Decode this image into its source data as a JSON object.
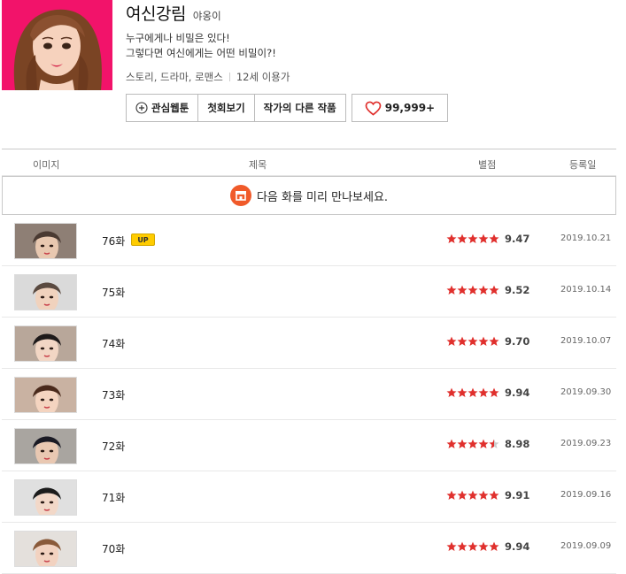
{
  "webtoon": {
    "title": "여신강림",
    "author": "야옹이",
    "synopsis": [
      "누구에게나 비밀은 있다!",
      "그렇다면 여신에게는 어떤 비밀이?!"
    ],
    "genres": "스토리, 드라마, 로맨스",
    "age_rating": "12세 이용가"
  },
  "buttons": {
    "interest": "관심웹툰",
    "first_episode": "첫회보기",
    "other_works": "작가의 다른 작품",
    "favorite_count": "99,999+"
  },
  "table": {
    "headers": {
      "image": "이미지",
      "title": "제목",
      "rating": "별점",
      "date": "등록일"
    },
    "notice": "다음 화를 미리 만나보세요."
  },
  "episodes": [
    {
      "title": "76화",
      "badge": "UP",
      "score": "9.47",
      "stars": 5,
      "date": "2019.10.21"
    },
    {
      "title": "75화",
      "badge": "",
      "score": "9.52",
      "stars": 5,
      "date": "2019.10.14"
    },
    {
      "title": "74화",
      "badge": "",
      "score": "9.70",
      "stars": 5,
      "date": "2019.10.07"
    },
    {
      "title": "73화",
      "badge": "",
      "score": "9.94",
      "stars": 5,
      "date": "2019.09.30"
    },
    {
      "title": "72화",
      "badge": "",
      "score": "8.98",
      "stars": 4.5,
      "date": "2019.09.23"
    },
    {
      "title": "71화",
      "badge": "",
      "score": "9.91",
      "stars": 5,
      "date": "2019.09.16"
    },
    {
      "title": "70화",
      "badge": "",
      "score": "9.94",
      "stars": 5,
      "date": "2019.09.09"
    }
  ],
  "colors": {
    "accent_red": "#e0302d",
    "cover_pink": "#f2136a",
    "up_badge": "#ffcc00",
    "notice_icon": "#f05a2a"
  }
}
